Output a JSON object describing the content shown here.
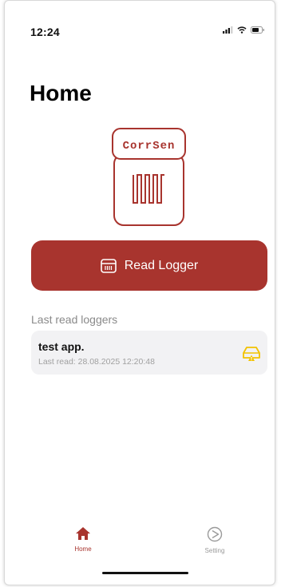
{
  "status_bar": {
    "time": "12:24"
  },
  "header": {
    "title": "Home"
  },
  "logo": {
    "text": "CorrSen",
    "color": "#a8342e"
  },
  "read_button": {
    "label": "Read Logger",
    "icon": "logger-icon",
    "color": "#a8342e"
  },
  "last_read": {
    "label": "Last read loggers",
    "items": [
      {
        "name": "test app.",
        "last_read": "Last read: 28.08.2025 12:20:48",
        "status_icon": "warning-icon",
        "status_color": "#f2c200"
      }
    ]
  },
  "tab_bar": {
    "tabs": [
      {
        "label": "Home",
        "icon": "home-icon",
        "active": true
      },
      {
        "label": "Setting",
        "icon": "settings-icon",
        "active": false
      }
    ],
    "active_color": "#a8342e",
    "inactive_color": "#9a9a9a"
  }
}
